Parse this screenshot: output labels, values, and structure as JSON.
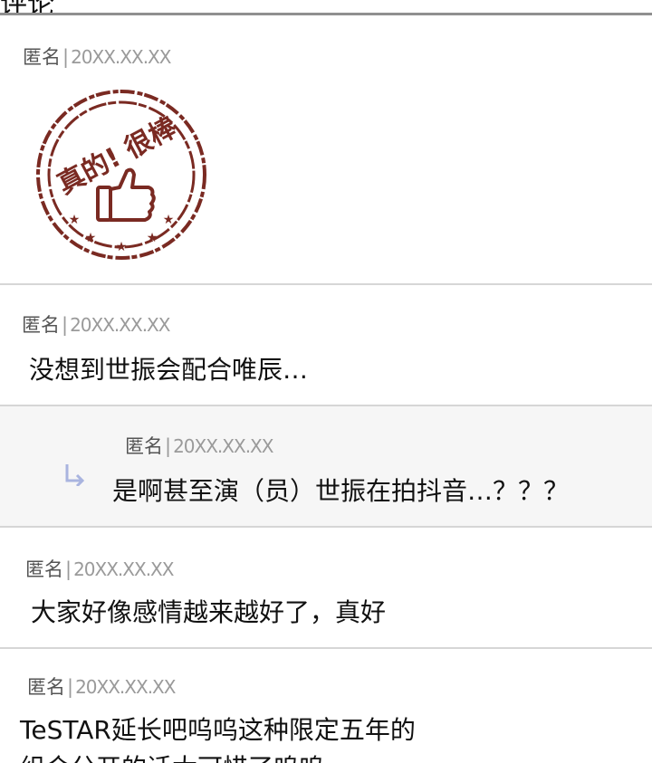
{
  "header": {
    "cut_title": "评论"
  },
  "comments": [
    {
      "author": "匿名",
      "date": "20XX.XX.XX",
      "sticker_text": "真的! 很棒"
    },
    {
      "author": "匿名",
      "date": "20XX.XX.XX",
      "text": "没想到世振会配合唯辰…"
    },
    {
      "author": "匿名",
      "date": "20XX.XX.XX",
      "text": "是啊甚至演（员）世振在拍抖音…？？？"
    },
    {
      "author": "匿名",
      "date": "20XX.XX.XX",
      "text": "大家好像感情越来越好了，真好"
    },
    {
      "author": "匿名",
      "date": "20XX.XX.XX",
      "text_line1": "TeSTAR延长吧呜呜这种限定五年的",
      "text_line2": "组合分开的话太可惜了呜呜"
    }
  ],
  "colors": {
    "stamp": "#7a2a22",
    "reply_arrow": "#a9b4df",
    "divider": "#d6d6d6"
  },
  "icons": {
    "reply": "reply-arrow-icon",
    "thumb": "thumbs-up-icon",
    "star": "star-icon"
  }
}
